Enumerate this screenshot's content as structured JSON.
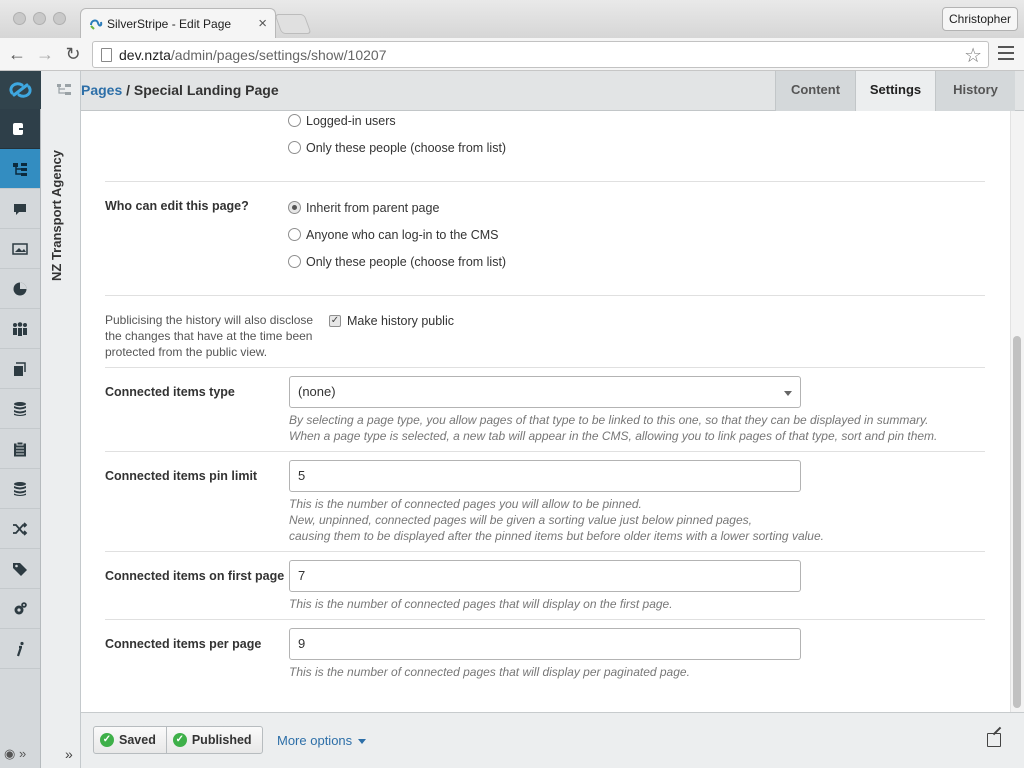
{
  "browser": {
    "tab_title": "SilverStripe - Edit Page",
    "tab_close": "×",
    "profile": "Christopher",
    "url_host": "dev.nzta",
    "url_path": "/admin/pages/settings/show/10207",
    "back": "←",
    "forward": "→",
    "reload": "↻",
    "star": "☆"
  },
  "cms_menu": {
    "bottom_glyphs": "◉ »"
  },
  "tree_panel": {
    "label": "NZ Transport Agency",
    "expand": "»"
  },
  "header": {
    "crumb_link": "Pages",
    "crumb_sep": " / ",
    "crumb_current": "Special Landing Page",
    "tabs": [
      "Content",
      "Settings",
      "History"
    ]
  },
  "viewers": {
    "options": [
      "Logged-in users",
      "Only these people (choose from list)"
    ]
  },
  "editors": {
    "label": "Who can edit this page?",
    "options": [
      "Inherit from parent page",
      "Anyone who can log-in to the CMS",
      "Only these people (choose from list)"
    ],
    "selected": 0
  },
  "history": {
    "description": "Publicising the history will also disclose the changes that have at the time been protected from the public view.",
    "checkbox_label": "Make history public",
    "checked": true
  },
  "connected_type": {
    "label": "Connected items type",
    "value": "(none)",
    "note_1": "By selecting a page type, you allow pages of that type to be linked to this one, so that they can be displayed in summary.",
    "note_2": "When a page type is selected, a new tab will appear in the CMS, allowing you to link pages of that type, sort and pin them."
  },
  "pin_limit": {
    "label": "Connected items pin limit",
    "value": "5",
    "note_1": "This is the number of connected pages you will allow to be pinned.",
    "note_2": "New, unpinned, connected pages will be given a sorting value just below pinned pages,",
    "note_3": "causing them to be displayed after the pinned items but before older items with a lower sorting value."
  },
  "first_page": {
    "label": "Connected items on first page",
    "value": "7",
    "note": "This is the number of connected pages that will display on the first page."
  },
  "per_page": {
    "label": "Connected items per page",
    "value": "9",
    "note": "This is the number of connected pages that will display per paginated page."
  },
  "footer": {
    "saved": "Saved",
    "published": "Published",
    "more_options": "More options",
    "check": "✓"
  }
}
